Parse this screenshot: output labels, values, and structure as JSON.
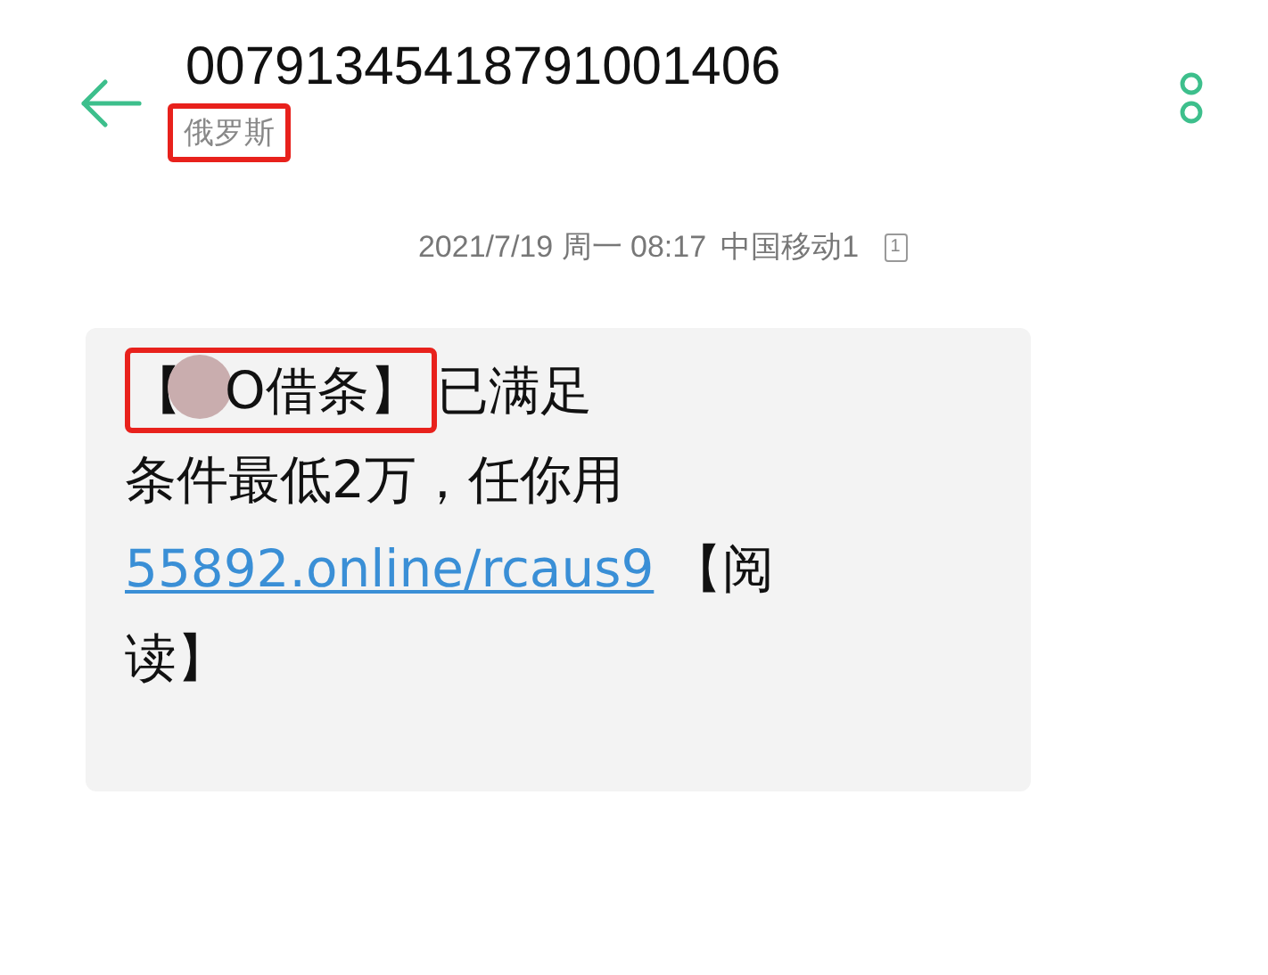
{
  "header": {
    "number": "00791345418791001406",
    "location": "俄罗斯",
    "location_highlighted": true
  },
  "timestamp": {
    "date": "2021/7/19 周一 08:17",
    "carrier": "中国移动1",
    "sim": "1"
  },
  "message": {
    "segments": [
      {
        "kind": "highlight",
        "children": [
          {
            "kind": "text",
            "text": "【"
          },
          {
            "kind": "redaction"
          },
          {
            "kind": "text",
            "text": "O借条】"
          }
        ]
      },
      {
        "kind": "text",
        "text": "已满足"
      },
      {
        "kind": "break"
      },
      {
        "kind": "text",
        "text": "条件最低2万，任你用"
      },
      {
        "kind": "break"
      },
      {
        "kind": "link",
        "text": "55892.online/rcaus9"
      },
      {
        "kind": "text",
        "text": " 【阅"
      },
      {
        "kind": "break"
      },
      {
        "kind": "text",
        "text": "读】"
      }
    ]
  }
}
